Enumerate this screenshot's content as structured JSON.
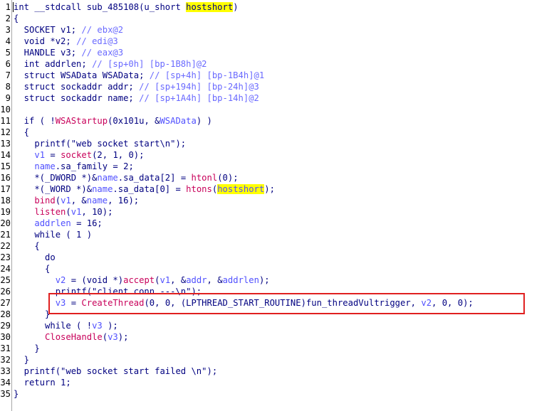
{
  "window": {
    "title": ""
  },
  "colors": {
    "keyword": "#000080",
    "local_variable": "#5050ff",
    "imported_function": "#c8005a",
    "comment": "#6a6aff",
    "search_highlight": "#ffff00",
    "annotation_box": "#e02020",
    "line_number": "#000000"
  },
  "annotation": {
    "type": "red-rectangle",
    "target_line": "27"
  },
  "lines": [
    {
      "n": "1",
      "tokens": [
        {
          "t": "int __stdcall sub_485108(u_short ",
          "c": "tok-kw",
          "name": "function-signature"
        },
        {
          "t": "hostshort",
          "c": "tok-kw tok-hl",
          "name": "highlighted-param"
        },
        {
          "t": ")",
          "c": "tok-punc",
          "name": "punct"
        }
      ]
    },
    {
      "n": "2",
      "tokens": [
        {
          "t": "{",
          "c": "tok-punc",
          "name": "brace"
        }
      ]
    },
    {
      "n": "3",
      "tokens": [
        {
          "t": "  SOCKET v1; ",
          "c": "tok-kw",
          "name": "decl"
        },
        {
          "t": "// ebx@2",
          "c": "tok-cmt",
          "name": "comment"
        }
      ]
    },
    {
      "n": "4",
      "tokens": [
        {
          "t": "  void *v2; ",
          "c": "tok-kw",
          "name": "decl"
        },
        {
          "t": "// edi@3",
          "c": "tok-cmt",
          "name": "comment"
        }
      ]
    },
    {
      "n": "5",
      "tokens": [
        {
          "t": "  HANDLE v3; ",
          "c": "tok-kw",
          "name": "decl"
        },
        {
          "t": "// eax@3",
          "c": "tok-cmt",
          "name": "comment"
        }
      ]
    },
    {
      "n": "6",
      "tokens": [
        {
          "t": "  int addrlen; ",
          "c": "tok-kw",
          "name": "decl"
        },
        {
          "t": "// [sp+0h] [bp-1B8h]@2",
          "c": "tok-cmt",
          "name": "comment"
        }
      ]
    },
    {
      "n": "7",
      "tokens": [
        {
          "t": "  struct WSAData WSAData; ",
          "c": "tok-kw",
          "name": "decl"
        },
        {
          "t": "// [sp+4h] [bp-1B4h]@1",
          "c": "tok-cmt",
          "name": "comment"
        }
      ]
    },
    {
      "n": "8",
      "tokens": [
        {
          "t": "  struct sockaddr addr; ",
          "c": "tok-kw",
          "name": "decl"
        },
        {
          "t": "// [sp+194h] [bp-24h]@3",
          "c": "tok-cmt",
          "name": "comment"
        }
      ]
    },
    {
      "n": "9",
      "tokens": [
        {
          "t": "  struct sockaddr name; ",
          "c": "tok-kw",
          "name": "decl"
        },
        {
          "t": "// [sp+1A4h] [bp-14h]@2",
          "c": "tok-cmt",
          "name": "comment"
        }
      ]
    },
    {
      "n": "10",
      "tokens": []
    },
    {
      "n": "11",
      "tokens": [
        {
          "t": "  if ( !",
          "c": "tok-kw",
          "name": "keyword"
        },
        {
          "t": "WSAStartup",
          "c": "tok-func",
          "name": "function-call"
        },
        {
          "t": "(0x101u, &",
          "c": "tok-kw",
          "name": "args"
        },
        {
          "t": "WSAData",
          "c": "tok-var",
          "name": "variable"
        },
        {
          "t": ") )",
          "c": "tok-punc",
          "name": "punct"
        }
      ]
    },
    {
      "n": "12",
      "tokens": [
        {
          "t": "  {",
          "c": "tok-punc",
          "name": "brace"
        }
      ]
    },
    {
      "n": "13",
      "tokens": [
        {
          "t": "    printf(\"web socket start\\n\");",
          "c": "tok-kw",
          "name": "statement"
        }
      ]
    },
    {
      "n": "14",
      "tokens": [
        {
          "t": "    ",
          "c": "tok-kw",
          "name": "indent"
        },
        {
          "t": "v1",
          "c": "tok-var",
          "name": "variable"
        },
        {
          "t": " = ",
          "c": "tok-kw",
          "name": "operator"
        },
        {
          "t": "socket",
          "c": "tok-func",
          "name": "function-call"
        },
        {
          "t": "(2, 1, 0);",
          "c": "tok-kw",
          "name": "args"
        }
      ]
    },
    {
      "n": "15",
      "tokens": [
        {
          "t": "    ",
          "c": "tok-kw",
          "name": "indent"
        },
        {
          "t": "name",
          "c": "tok-var",
          "name": "variable"
        },
        {
          "t": ".sa_family = 2;",
          "c": "tok-kw",
          "name": "statement"
        }
      ]
    },
    {
      "n": "16",
      "tokens": [
        {
          "t": "    *(_DWORD *)&",
          "c": "tok-kw",
          "name": "cast"
        },
        {
          "t": "name",
          "c": "tok-var",
          "name": "variable"
        },
        {
          "t": ".sa_data[2] = ",
          "c": "tok-kw",
          "name": "statement"
        },
        {
          "t": "htonl",
          "c": "tok-func",
          "name": "function-call"
        },
        {
          "t": "(0);",
          "c": "tok-kw",
          "name": "args"
        }
      ]
    },
    {
      "n": "17",
      "tokens": [
        {
          "t": "    *(_WORD *)&",
          "c": "tok-kw",
          "name": "cast"
        },
        {
          "t": "name",
          "c": "tok-var",
          "name": "variable"
        },
        {
          "t": ".sa_data[0] = ",
          "c": "tok-kw",
          "name": "statement"
        },
        {
          "t": "htons",
          "c": "tok-func",
          "name": "function-call"
        },
        {
          "t": "(",
          "c": "tok-kw",
          "name": "punct"
        },
        {
          "t": "hostshort",
          "c": "tok-var tok-hl",
          "name": "highlighted-param"
        },
        {
          "t": ");",
          "c": "tok-kw",
          "name": "punct"
        }
      ]
    },
    {
      "n": "18",
      "tokens": [
        {
          "t": "    ",
          "c": "tok-kw",
          "name": "indent"
        },
        {
          "t": "bind",
          "c": "tok-func",
          "name": "function-call"
        },
        {
          "t": "(",
          "c": "tok-kw",
          "name": "punct"
        },
        {
          "t": "v1",
          "c": "tok-var",
          "name": "variable"
        },
        {
          "t": ", &",
          "c": "tok-kw",
          "name": "punct"
        },
        {
          "t": "name",
          "c": "tok-var",
          "name": "variable"
        },
        {
          "t": ", 16);",
          "c": "tok-kw",
          "name": "args"
        }
      ]
    },
    {
      "n": "19",
      "tokens": [
        {
          "t": "    ",
          "c": "tok-kw",
          "name": "indent"
        },
        {
          "t": "listen",
          "c": "tok-func",
          "name": "function-call"
        },
        {
          "t": "(",
          "c": "tok-kw",
          "name": "punct"
        },
        {
          "t": "v1",
          "c": "tok-var",
          "name": "variable"
        },
        {
          "t": ", 10);",
          "c": "tok-kw",
          "name": "args"
        }
      ]
    },
    {
      "n": "20",
      "tokens": [
        {
          "t": "    ",
          "c": "tok-kw",
          "name": "indent"
        },
        {
          "t": "addrlen",
          "c": "tok-var",
          "name": "variable"
        },
        {
          "t": " = 16;",
          "c": "tok-kw",
          "name": "statement"
        }
      ]
    },
    {
      "n": "21",
      "tokens": [
        {
          "t": "    while ( 1 )",
          "c": "tok-kw",
          "name": "keyword"
        }
      ]
    },
    {
      "n": "22",
      "tokens": [
        {
          "t": "    {",
          "c": "tok-punc",
          "name": "brace"
        }
      ]
    },
    {
      "n": "23",
      "tokens": [
        {
          "t": "      do",
          "c": "tok-kw",
          "name": "keyword"
        }
      ]
    },
    {
      "n": "24",
      "tokens": [
        {
          "t": "      {",
          "c": "tok-punc",
          "name": "brace"
        }
      ]
    },
    {
      "n": "25",
      "tokens": [
        {
          "t": "        ",
          "c": "tok-kw",
          "name": "indent"
        },
        {
          "t": "v2",
          "c": "tok-var",
          "name": "variable"
        },
        {
          "t": " = (void *)",
          "c": "tok-kw",
          "name": "cast"
        },
        {
          "t": "accept",
          "c": "tok-func",
          "name": "function-call"
        },
        {
          "t": "(",
          "c": "tok-kw",
          "name": "punct"
        },
        {
          "t": "v1",
          "c": "tok-var",
          "name": "variable"
        },
        {
          "t": ", &",
          "c": "tok-kw",
          "name": "punct"
        },
        {
          "t": "addr",
          "c": "tok-var",
          "name": "variable"
        },
        {
          "t": ", &",
          "c": "tok-kw",
          "name": "punct"
        },
        {
          "t": "addrlen",
          "c": "tok-var",
          "name": "variable"
        },
        {
          "t": ");",
          "c": "tok-kw",
          "name": "punct"
        }
      ]
    },
    {
      "n": "26",
      "tokens": [
        {
          "t": "        printf(\"client conn ---\\n\");",
          "c": "tok-kw",
          "name": "statement"
        }
      ]
    },
    {
      "n": "27",
      "tokens": [
        {
          "t": "        ",
          "c": "tok-kw",
          "name": "indent"
        },
        {
          "t": "v3",
          "c": "tok-var",
          "name": "variable"
        },
        {
          "t": " = ",
          "c": "tok-kw",
          "name": "operator"
        },
        {
          "t": "CreateThread",
          "c": "tok-func",
          "name": "function-call"
        },
        {
          "t": "(0, 0, (LPTHREAD_START_ROUTINE)fun_threadVultrigger, ",
          "c": "tok-kw",
          "name": "args"
        },
        {
          "t": "v2",
          "c": "tok-var",
          "name": "variable"
        },
        {
          "t": ", 0, 0);",
          "c": "tok-kw",
          "name": "args"
        }
      ]
    },
    {
      "n": "28",
      "tokens": [
        {
          "t": "      }",
          "c": "tok-punc",
          "name": "brace"
        }
      ]
    },
    {
      "n": "29",
      "tokens": [
        {
          "t": "      while ( !",
          "c": "tok-kw",
          "name": "keyword"
        },
        {
          "t": "v3",
          "c": "tok-var",
          "name": "variable"
        },
        {
          "t": " );",
          "c": "tok-kw",
          "name": "punct"
        }
      ]
    },
    {
      "n": "30",
      "tokens": [
        {
          "t": "      ",
          "c": "tok-kw",
          "name": "indent"
        },
        {
          "t": "CloseHandle",
          "c": "tok-func",
          "name": "function-call"
        },
        {
          "t": "(",
          "c": "tok-kw",
          "name": "punct"
        },
        {
          "t": "v3",
          "c": "tok-var",
          "name": "variable"
        },
        {
          "t": ");",
          "c": "tok-kw",
          "name": "punct"
        }
      ]
    },
    {
      "n": "31",
      "tokens": [
        {
          "t": "    }",
          "c": "tok-punc",
          "name": "brace"
        }
      ]
    },
    {
      "n": "32",
      "tokens": [
        {
          "t": "  }",
          "c": "tok-punc",
          "name": "brace"
        }
      ]
    },
    {
      "n": "33",
      "tokens": [
        {
          "t": "  printf(\"web socket start failed \\n\");",
          "c": "tok-kw",
          "name": "statement"
        }
      ]
    },
    {
      "n": "34",
      "tokens": [
        {
          "t": "  return 1;",
          "c": "tok-kw",
          "name": "keyword"
        }
      ]
    },
    {
      "n": "35",
      "tokens": [
        {
          "t": "}",
          "c": "tok-punc",
          "name": "brace"
        }
      ]
    }
  ]
}
